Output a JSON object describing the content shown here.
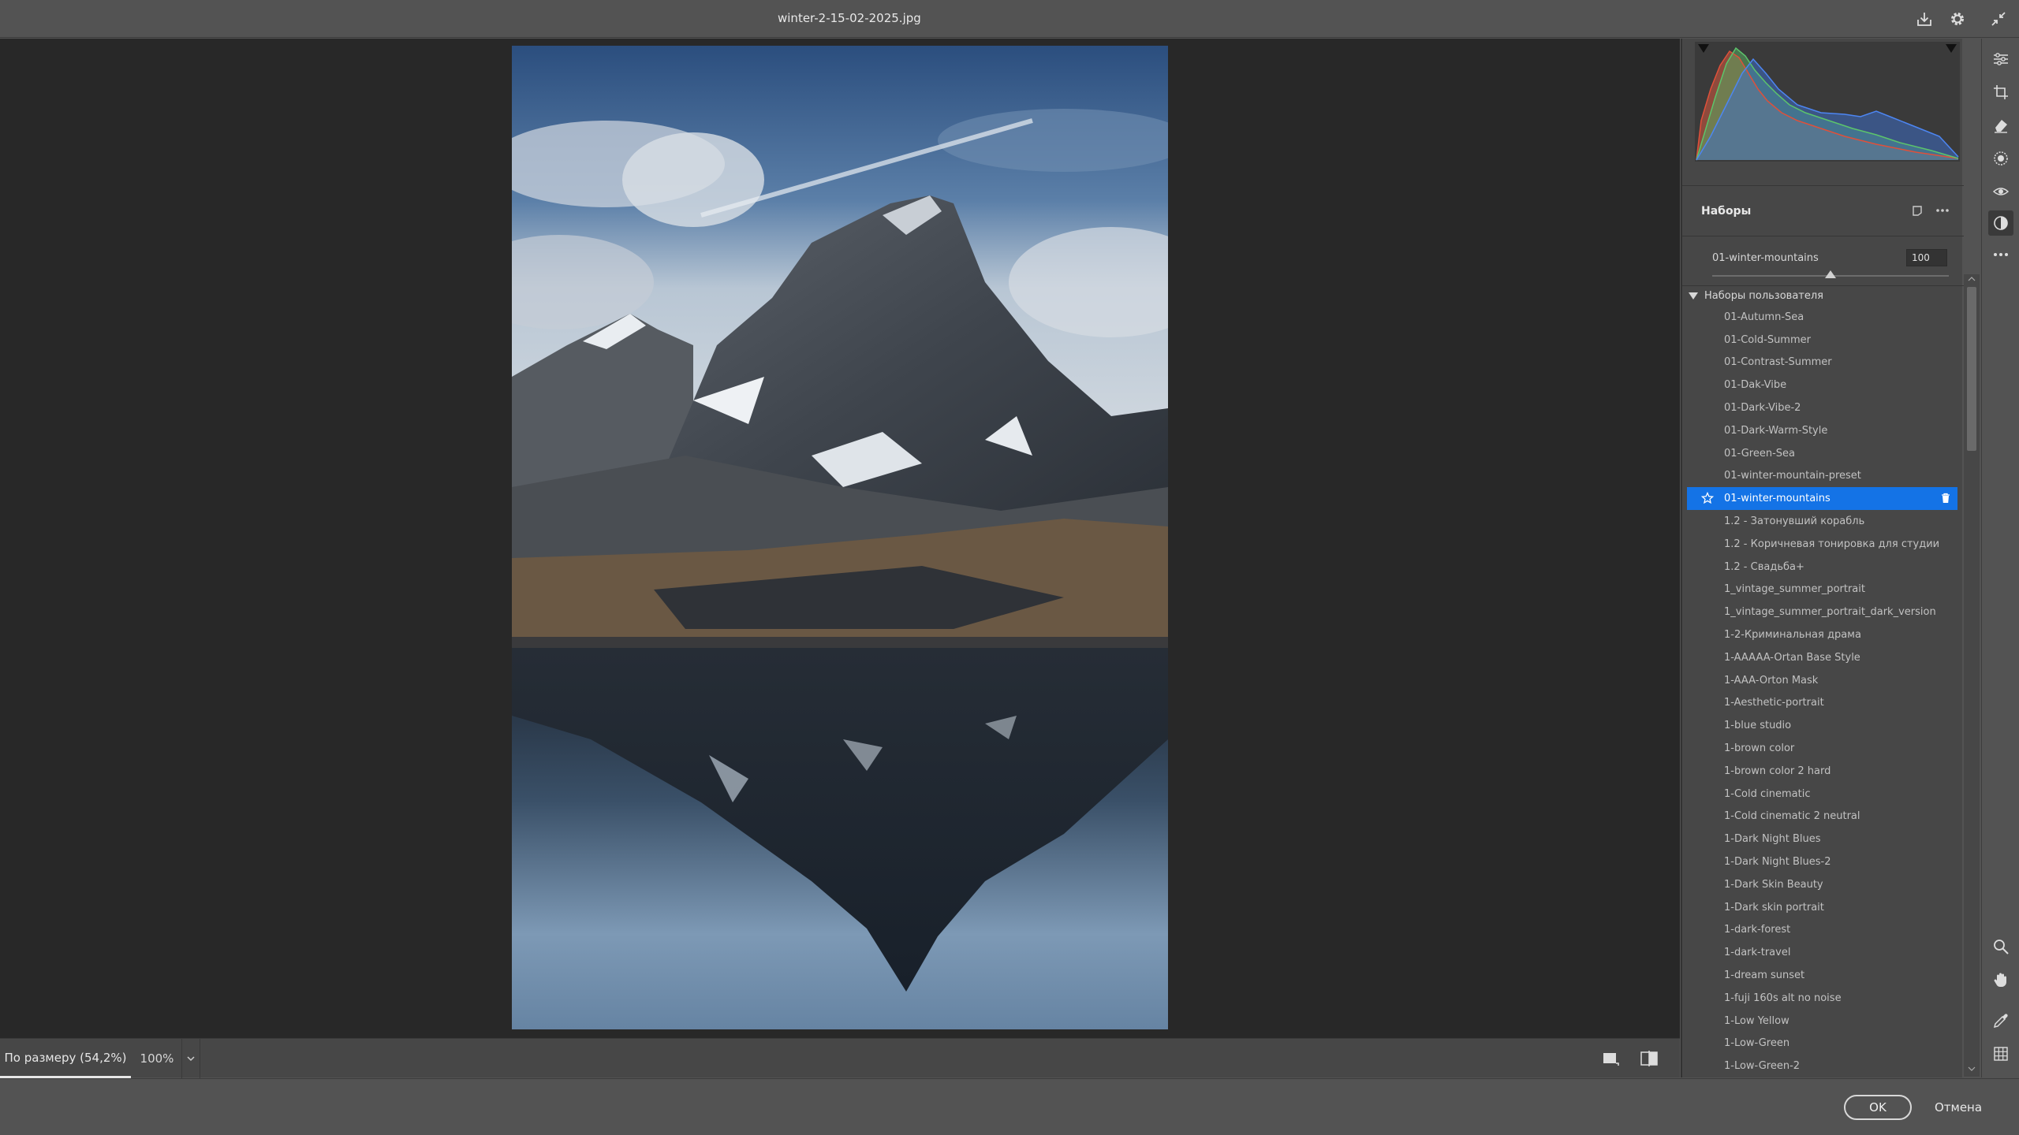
{
  "window": {
    "title": "winter-2-15-02-2025.jpg"
  },
  "titlebar_icons": [
    "save-download-icon",
    "gear-icon",
    "collapse-icon"
  ],
  "zoombar": {
    "fit_label": "По размеру (54,2%)",
    "zoom_label": "100%"
  },
  "presets": {
    "title": "Наборы",
    "current_name": "01-winter-mountains",
    "amount": "100",
    "amount_value": 100,
    "group_title": "Наборы пользователя",
    "items": [
      "01-Autumn-Sea",
      "01-Cold-Summer",
      "01-Contrast-Summer",
      "01-Dak-Vibe",
      "01-Dark-Vibe-2",
      "01-Dark-Warm-Style",
      "01-Green-Sea",
      "01-winter-mountain-preset",
      "01-winter-mountains",
      "1.2 - Затонувший корабль",
      "1.2 - Коричневая тонировка для студии",
      "1.2 - Свадьба+",
      "1_vintage_summer_portrait",
      "1_vintage_summer_portrait_dark_version",
      "1-2-Криминальная драма",
      "1-AAAAA-Ortan Base Style",
      "1-AAA-Orton Mask",
      "1-Aesthetic-portrait",
      "1-blue studio",
      "1-brown color",
      "1-brown color 2 hard",
      "1-Cold cinematic",
      "1-Cold cinematic 2 neutral",
      "1-Dark Night Blues",
      "1-Dark Night Blues-2",
      "1-Dark Skin Beauty",
      "1-Dark skin portrait",
      "1-dark-forest",
      "1-dark-travel",
      "1-dream sunset",
      "1-fuji 160s alt no noise",
      "1-Low Yellow",
      "1-Low-Green",
      "1-Low-Green-2"
    ],
    "selected_index": 8
  },
  "buttons": {
    "ok": "OK",
    "cancel": "Отмена"
  },
  "colors": {
    "accent": "#1473e6",
    "panel": "#474747",
    "canvas": "#282828",
    "chrome": "#535353"
  }
}
